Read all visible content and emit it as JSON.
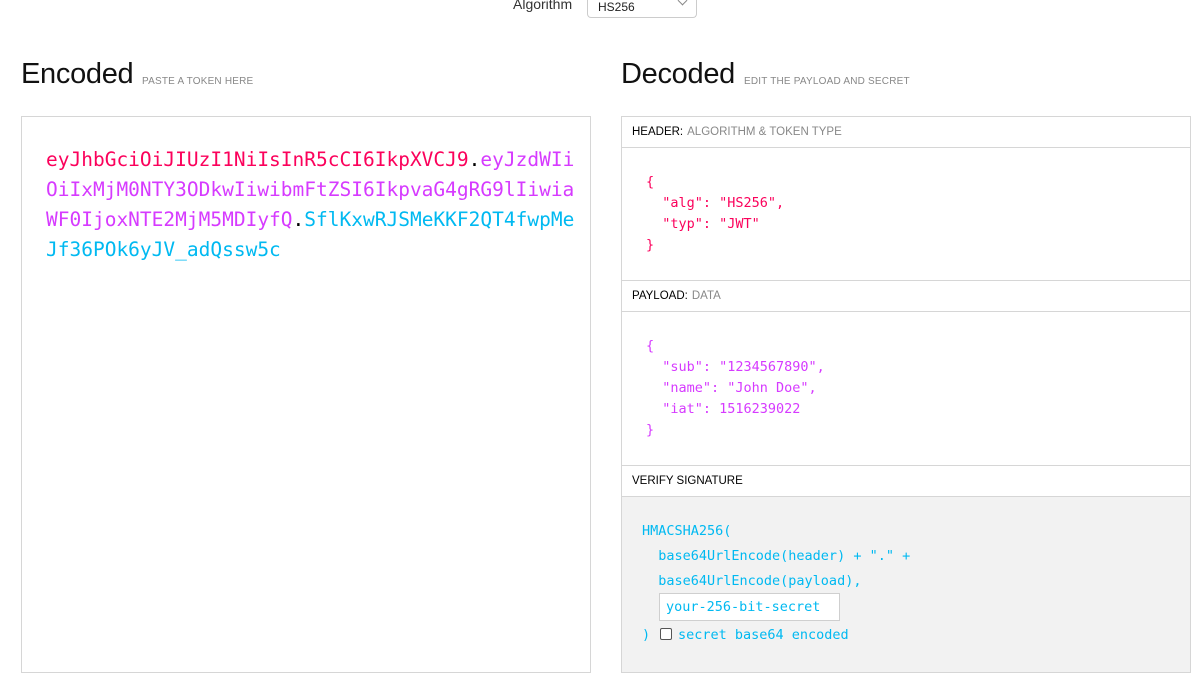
{
  "algorithm": {
    "label": "Algorithm",
    "value": "HS256"
  },
  "encoded": {
    "title": "Encoded",
    "subtitle": "PASTE A TOKEN HERE",
    "token_header": "eyJhbGciOiJIUzI1NiIsInR5cCI6IkpXVCJ9",
    "token_payload": "eyJzdWIiOiIxMjM0NTY3ODkwIiwibmFtZSI6IkpvaG4gRG9lIiwiaWF0IjoxNTE2MjM5MDIyfQ",
    "token_signature": "SflKxwRJSMeKKF2QT4fwpMeJf36POk6yJV_adQssw5c",
    "dot": "."
  },
  "decoded": {
    "title": "Decoded",
    "subtitle": "EDIT THE PAYLOAD AND SECRET",
    "header_section": {
      "label": "HEADER:",
      "muted": "ALGORITHM & TOKEN TYPE",
      "json": "{\n  \"alg\": \"HS256\",\n  \"typ\": \"JWT\"\n}"
    },
    "payload_section": {
      "label": "PAYLOAD:",
      "muted": "DATA",
      "json": "{\n  \"sub\": \"1234567890\",\n  \"name\": \"John Doe\",\n  \"iat\": 1516239022\n}"
    },
    "verify_section": {
      "label": "VERIFY SIGNATURE",
      "code": "HMACSHA256(\n  base64UrlEncode(header) + \".\" +\n  base64UrlEncode(payload),",
      "secret_value": "your-256-bit-secret",
      "close_paren": ")",
      "checkbox_label": "secret base64 encoded",
      "checkbox_checked": false
    }
  },
  "colors": {
    "header": "#fb015b",
    "payload": "#d63aff",
    "signature": "#00b9f1"
  }
}
